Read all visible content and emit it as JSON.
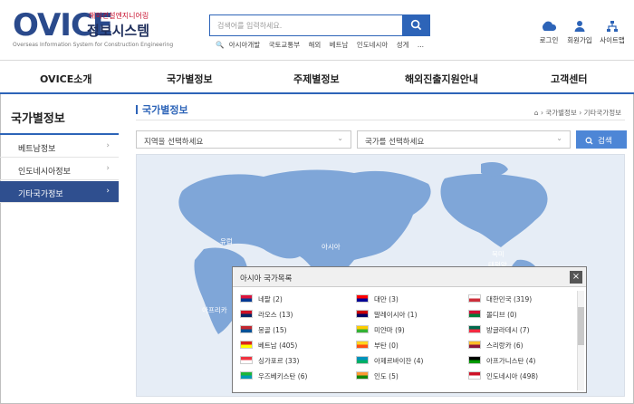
{
  "logo": {
    "main": "OVICE",
    "sub_top": "해외건설엔지니어링",
    "sub_name": "정보시스템",
    "sub_en": "Overseas Information System for Construction Engineering"
  },
  "search": {
    "placeholder": "검색어를 입력하세요.",
    "keywords": [
      "아시아개발",
      "국토교통부",
      "해외",
      "베트남",
      "인도네시아",
      "성게",
      "..."
    ]
  },
  "utility": [
    {
      "label": "로그인",
      "icon": "login-icon"
    },
    {
      "label": "회원가입",
      "icon": "user-add-icon"
    },
    {
      "label": "사이트맵",
      "icon": "sitemap-icon"
    }
  ],
  "nav": [
    "OVICE소개",
    "국가별정보",
    "주제별정보",
    "해외진출지원안내",
    "고객센터"
  ],
  "sidebar": {
    "title": "국가별정보",
    "items": [
      {
        "label": "베트남정보",
        "active": false
      },
      {
        "label": "인도네시아정보",
        "active": false
      },
      {
        "label": "기타국가정보",
        "active": true
      }
    ]
  },
  "content": {
    "title": "국가별정보",
    "breadcrumb": "› 국가별정보 › 기타국가정보",
    "region_select": "지역을 선택하세요",
    "country_select": "국가를 선택하세요",
    "search_button": "검색"
  },
  "map": {
    "labels": [
      "유럽",
      "아시아",
      "아프리카",
      "북미",
      "태평양"
    ]
  },
  "popup": {
    "title": "아시아 국가목록",
    "countries": [
      {
        "name": "네팔 (2)",
        "flag": [
          "#dc143c",
          "#003893"
        ]
      },
      {
        "name": "대만 (3)",
        "flag": [
          "#fe0000",
          "#000095"
        ]
      },
      {
        "name": "대한민국 (319)",
        "flag": [
          "#ffffff",
          "#cd2e3a"
        ]
      },
      {
        "name": "라오스 (13)",
        "flag": [
          "#ce1126",
          "#002868"
        ]
      },
      {
        "name": "말레이시아 (1)",
        "flag": [
          "#cc0001",
          "#010066"
        ]
      },
      {
        "name": "몰디브 (0)",
        "flag": [
          "#d21034",
          "#007e3a"
        ]
      },
      {
        "name": "몽골 (15)",
        "flag": [
          "#c4272f",
          "#015197"
        ]
      },
      {
        "name": "미얀마 (9)",
        "flag": [
          "#fecb00",
          "#34b233"
        ]
      },
      {
        "name": "방글라데시 (7)",
        "flag": [
          "#006a4e",
          "#f42a41"
        ]
      },
      {
        "name": "베트남 (405)",
        "flag": [
          "#da251d",
          "#ffff00"
        ]
      },
      {
        "name": "부탄 (0)",
        "flag": [
          "#ffd520",
          "#ff4e12"
        ]
      },
      {
        "name": "스리랑카 (6)",
        "flag": [
          "#ffbe29",
          "#8d153a"
        ]
      },
      {
        "name": "싱가포르 (33)",
        "flag": [
          "#ef3340",
          "#ffffff"
        ]
      },
      {
        "name": "아제르바이잔 (4)",
        "flag": [
          "#0092bc",
          "#00af66"
        ]
      },
      {
        "name": "아프가니스탄 (4)",
        "flag": [
          "#000000",
          "#009a00"
        ]
      },
      {
        "name": "우즈베키스탄 (6)",
        "flag": [
          "#1eb53a",
          "#0099b5"
        ]
      },
      {
        "name": "인도 (5)",
        "flag": [
          "#ff9933",
          "#138808"
        ]
      },
      {
        "name": "인도네시아 (498)",
        "flag": [
          "#ce1126",
          "#ffffff"
        ]
      }
    ]
  },
  "colors": {
    "brand_blue": "#2d64b8",
    "active_nav": "#2f4f8f",
    "map_land": "#7fa6d8",
    "map_bg": "#e6edf6"
  }
}
